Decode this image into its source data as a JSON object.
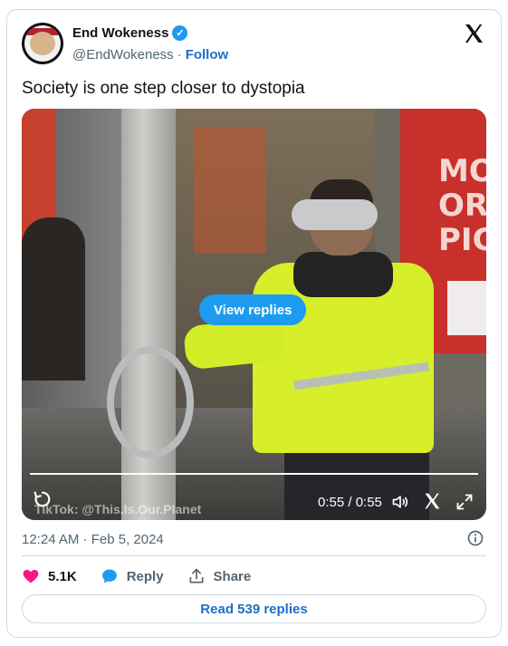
{
  "author": {
    "display_name": "End Wokeness",
    "handle": "@EndWokeness",
    "separator": "·",
    "follow_label": "Follow",
    "verified": true
  },
  "tweet": {
    "text": "Society is one step closer to dystopia",
    "timestamp": "12:24 AM · Feb 5, 2024"
  },
  "video": {
    "view_replies_label": "View replies",
    "watermark": "TikTok: @This.Is.Our.Planet",
    "time": "0:55 / 0:55",
    "sign_text": "MO\nOR\nPIC"
  },
  "actions": {
    "likes": "5.1K",
    "reply_label": "Reply",
    "share_label": "Share"
  },
  "read_replies_label": "Read 539 replies",
  "colors": {
    "accent": "#1d9bf0",
    "link": "#1d6fc9",
    "like": "#f91880"
  }
}
